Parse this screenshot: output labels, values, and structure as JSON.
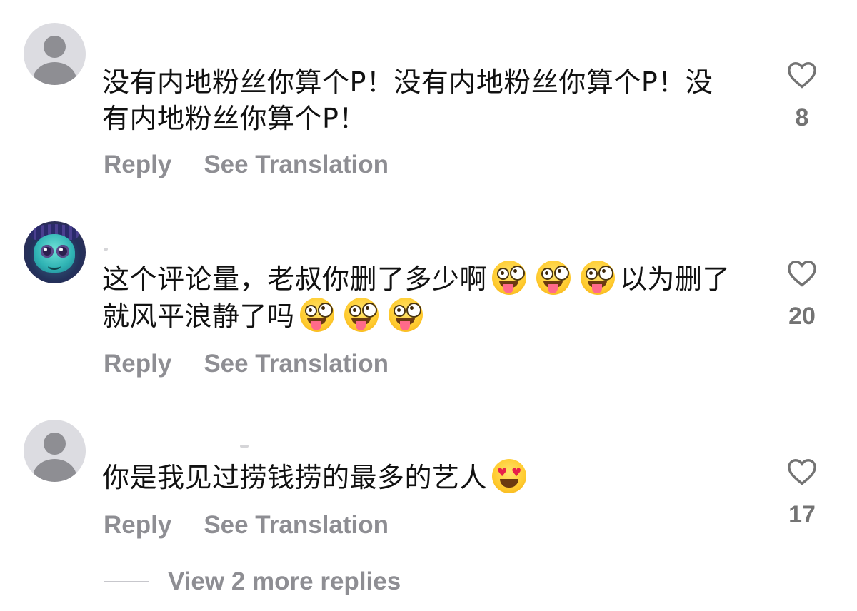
{
  "comments": [
    {
      "text": "没有内地粉丝你算个P！没有内地粉丝你算个P！没有内地粉丝你算个P！",
      "likes": "8",
      "reply_label": "Reply",
      "translate_label": "See Translation",
      "avatar": "default-person-icon"
    },
    {
      "text_before": "这个评论量，老叔你删了多少啊",
      "text_middle": "以为删了就风平浪静了吗",
      "likes": "20",
      "reply_label": "Reply",
      "translate_label": "See Translation",
      "avatar": "cartoon-character-avatar",
      "emoji": "zany-face"
    },
    {
      "text": "你是我见过捞钱捞的最多的艺人",
      "likes": "17",
      "reply_label": "Reply",
      "translate_label": "See Translation",
      "avatar": "default-person-icon",
      "emoji": "heart-eyes-face"
    }
  ],
  "view_more": "View 2 more replies",
  "colors": {
    "secondary_text": "#8e8e93",
    "like_count": "#737373",
    "body_text": "#111111"
  },
  "icons": {
    "like": "heart-outline-icon"
  }
}
